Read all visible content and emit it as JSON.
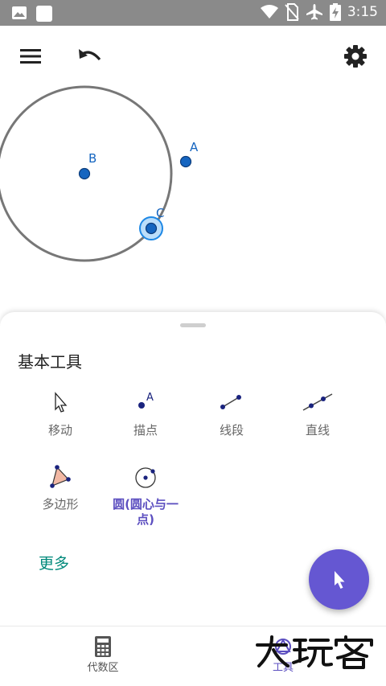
{
  "status_bar": {
    "time": "3:15",
    "icons": [
      "image-icon",
      "notification-square-icon",
      "wifi-icon",
      "no-sim-icon",
      "airplane-icon",
      "battery-charging-icon"
    ]
  },
  "toolbar": {
    "icons": [
      "menu-icon",
      "undo-icon",
      "settings-icon"
    ]
  },
  "canvas": {
    "points": [
      {
        "label": "A"
      },
      {
        "label": "B"
      },
      {
        "label": "C"
      }
    ],
    "colors": {
      "circle": "#777777",
      "point": "#1565c0",
      "selection_halo": "#90caf9"
    }
  },
  "tools_panel": {
    "title": "基本工具",
    "tools": [
      {
        "label": "移动",
        "icon": "move-arrow-icon"
      },
      {
        "label": "描点",
        "icon": "point-icon"
      },
      {
        "label": "线段",
        "icon": "segment-icon"
      },
      {
        "label": "直线",
        "icon": "line-icon"
      },
      {
        "label": "多边形",
        "icon": "polygon-icon"
      },
      {
        "label": "圆(圆心与一点)",
        "icon": "circle-center-point-icon",
        "selected": true
      }
    ],
    "more_label": "更多"
  },
  "fab": {
    "icon": "cursor-arrow-icon",
    "color": "#6557d2"
  },
  "bottom_nav": {
    "items": [
      {
        "label": "代数区",
        "icon": "calculator-icon"
      },
      {
        "label": "工具",
        "icon": "tools-icon",
        "active": true
      }
    ]
  },
  "watermark": {
    "text": "大玩客"
  }
}
